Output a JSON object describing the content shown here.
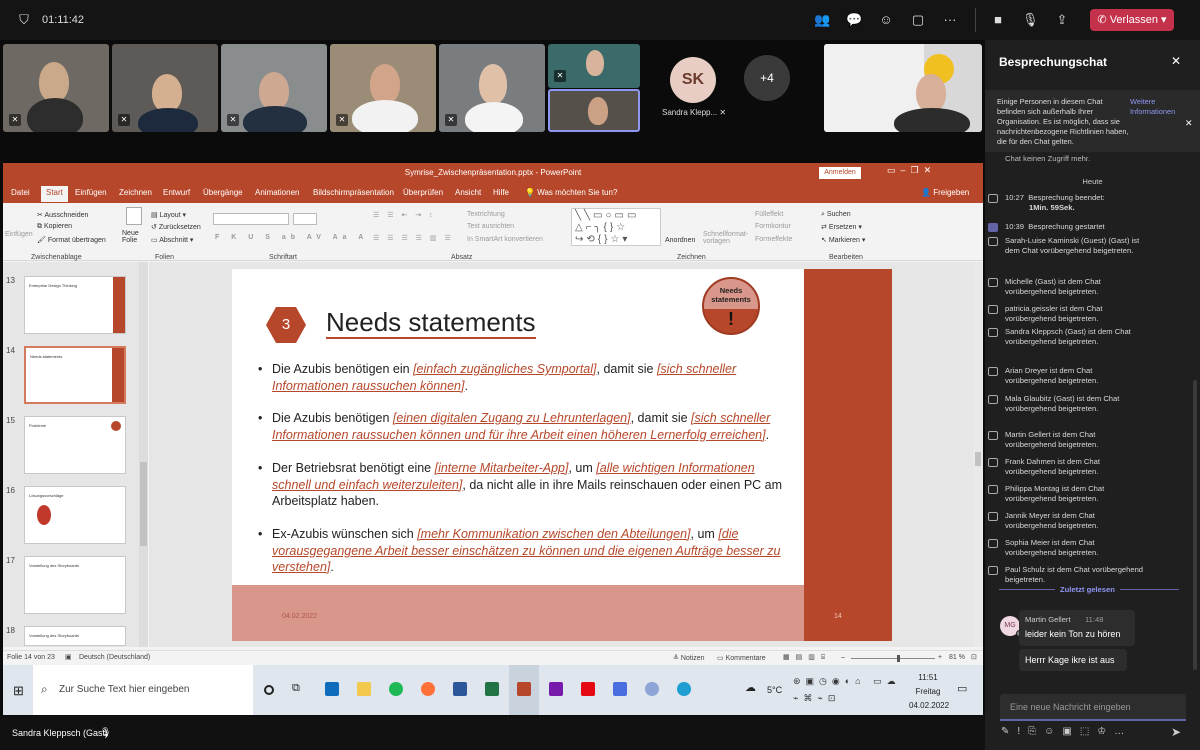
{
  "meeting": {
    "timer": "01:11:42",
    "leave_label": "Verlassen"
  },
  "participants": {
    "sk_initials": "SK",
    "sk_name": "Sandra Klepp...",
    "more": "+4"
  },
  "ppt": {
    "title": "Symrise_Zwischenpräsentation.pptx - PowerPoint",
    "signin": "Anmelden",
    "menu": [
      "Datei",
      "Start",
      "Einfügen",
      "Zeichnen",
      "Entwurf",
      "Übergänge",
      "Animationen",
      "Bildschirmpräsentation",
      "Überprüfen",
      "Ansicht",
      "Hilfe",
      "Was möchten Sie tun?"
    ],
    "share": "Freigeben",
    "ribbon": {
      "paste": "Einfügen",
      "cut": "Ausschneiden",
      "copy": "Kopieren",
      "format": "Format übertragen",
      "clipboard": "Zwischenablage",
      "new_slide": "Neue Folie",
      "layout": "Layout",
      "reset": "Zurücksetzen",
      "section": "Abschnitt",
      "slides": "Folien",
      "font": "Schriftart",
      "paragraph": "Absatz",
      "textdir": "Textrichtung",
      "align": "Text ausrichten",
      "smartart": "In SmartArt konvertieren",
      "arrange": "Anordnen",
      "quick": "Schnellformat-vorlagen",
      "fill": "Fülleffekt",
      "outline": "Formkontur",
      "effects": "Formeffekte",
      "drawing": "Zeichnen",
      "find": "Suchen",
      "replace": "Ersetzen",
      "select": "Markieren",
      "editing": "Bearbeiten"
    },
    "thumbs": [
      {
        "n": "13",
        "t": "Enterprise Design Thinking"
      },
      {
        "n": "14",
        "t": "Needs statements"
      },
      {
        "n": "15",
        "t": "Probleme"
      },
      {
        "n": "16",
        "t": "Lösungsvorschläge"
      },
      {
        "n": "17",
        "t": "Vorstellung des Storyboards"
      },
      {
        "n": "18",
        "t": "Vorstellung des Storyboards"
      }
    ],
    "slide": {
      "number": "3",
      "heading": "Needs statements",
      "badge": "Needs statements",
      "badge_mark": "!",
      "bullets": [
        {
          "a": "Die Azubis benötigen ein ",
          "b": "[einfach zugängliches Symportal]",
          "c": ", damit sie ",
          "d": "[sich schneller Informationen raussuchen können]",
          "e": "."
        },
        {
          "a": "Die Azubis benötigen ",
          "b": "[einen digitalen Zugang zu Lehrunterlagen]",
          "c": ", damit sie ",
          "d": "[sich schneller Informationen raussuchen können und für ihre Arbeit einen höheren Lernerfolg erreichen]",
          "e": "."
        },
        {
          "a": "Der Betriebsrat benötigt eine ",
          "b": "[interne Mitarbeiter-App]",
          "c": ", um ",
          "d": "[alle wichtigen Informationen schnell und einfach weiterzuleiten]",
          "e": ", da nicht alle in ihre Mails reinschauen oder einen PC am Arbeitsplatz haben."
        },
        {
          "a": "Ex-Azubis wünschen sich ",
          "b": "[mehr Kommunikation zwischen den Abteilungen]",
          "c": ", um ",
          "d": "[die vorausgegangene Arbeit besser einschätzen zu können und die eigenen Aufträge besser zu verstehen]",
          "e": "."
        }
      ],
      "footer_date": "04.02.2022",
      "footer_page": "14"
    },
    "status": {
      "slide": "Folie 14 von 23",
      "lang": "Deutsch (Deutschland)",
      "notes": "Notizen",
      "comments": "Kommentare",
      "zoom": "81 %"
    }
  },
  "taskbar": {
    "search_placeholder": "Zur Suche Text hier eingeben",
    "weather": "5°C",
    "time": "11:51",
    "day": "Freitag",
    "date": "04.02.2022"
  },
  "bottom": {
    "presenter": "Sandra Kleppsch (Gast)"
  },
  "chat": {
    "title": "Besprechungschat",
    "notice": "Einige Personen in diesem Chat befinden sich außerhalb Ihrer Organisation. Es ist möglich, dass sie nachrichtenbezogene Richtlinien haben, die für den Chat gelten.",
    "notice_link": "Weitere Informationen",
    "cut": "Chat keinen Zugriff mehr.",
    "today": "Heute",
    "ended_time": "10:27",
    "ended_label": "Besprechung beendet:",
    "ended_dur": "1Min. 59Sek.",
    "started_time": "10:39",
    "started_label": "Besprechung gestartet",
    "events": [
      "Sarah-Luise Kaminski (Guest) (Gast) ist dem Chat vorübergehend beigetreten.",
      "Michelle (Gast) ist dem Chat vorübergehend beigetreten.",
      "patricia.geissler ist dem Chat vorübergehend beigetreten.",
      "Sandra Kleppsch (Gast) ist dem Chat vorübergehend beigetreten.",
      "Arian Dreyer ist dem Chat vorübergehend beigetreten.",
      "Mala Glaubitz (Gast) ist dem Chat vorübergehend beigetreten.",
      "Martin Gellert ist dem Chat vorübergehend beigetreten.",
      "Frank Dahmen ist dem Chat vorübergehend beigetreten.",
      "Philippa Montag ist dem Chat vorübergehend beigetreten.",
      "Jannik Meyer ist dem Chat vorübergehend beigetreten.",
      "Sophia Meier ist dem Chat vorübergehend beigetreten.",
      "Paul Schulz ist dem Chat vorübergehend beigetreten."
    ],
    "last_read": "Zuletzt gelesen",
    "msg": {
      "avatar": "MG",
      "author": "Martin Gellert",
      "time": "11:48",
      "text": "leider kein Ton zu hören",
      "text2": "Herrr Kage ikre ist aus"
    },
    "input_placeholder": "Eine neue Nachricht eingeben"
  },
  "colors": {
    "ppt": "#b7472a",
    "teams_red": "#c4314b",
    "link": "#8f96f0"
  }
}
